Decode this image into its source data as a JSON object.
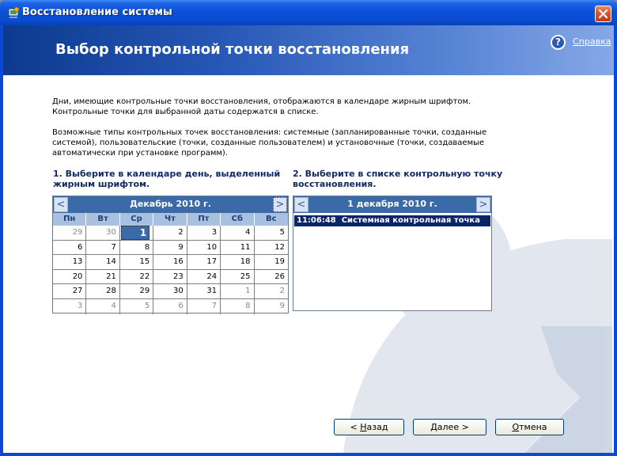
{
  "window": {
    "title": "Восстановление системы",
    "colors": {
      "titlebar": "#0a4bd0",
      "close": "#d8502c"
    }
  },
  "header": {
    "title": "Выбор контрольной точки восстановления",
    "help_label": "Справка",
    "help_glyph": "?"
  },
  "info": {
    "para1_line1": "Дни, имеющие контрольные точки восстановления, отображаются в календаре жирным шрифтом.",
    "para1_line2": "Контрольные точки для выбранной даты содержатся в списке.",
    "para2_line1": "Возможные типы контрольных точек восстановления: системные (запланированные точки, созданные",
    "para2_line2": "системой), пользовательские (точки, созданные пользователем) и установочные (точки, создаваемые",
    "para2_line3": "автоматически при установке программ)."
  },
  "step1": {
    "line1": "1. Выберите в календаре день, выделенный",
    "line2": "жирным шрифтом."
  },
  "step2": {
    "line1": "2. Выберите в списке контрольную точку",
    "line2": "восстановления."
  },
  "calendar": {
    "month_label": "Декабрь 2010 г.",
    "prev": "<",
    "next": ">",
    "weekdays": [
      "Пн",
      "Вт",
      "Ср",
      "Чт",
      "Пт",
      "Сб",
      "Вс"
    ],
    "weeks": [
      [
        "29",
        "30",
        "1",
        "2",
        "3",
        "4",
        "5"
      ],
      [
        "6",
        "7",
        "8",
        "9",
        "10",
        "11",
        "12"
      ],
      [
        "13",
        "14",
        "15",
        "16",
        "17",
        "18",
        "19"
      ],
      [
        "20",
        "21",
        "22",
        "23",
        "24",
        "25",
        "26"
      ],
      [
        "27",
        "28",
        "29",
        "30",
        "31",
        "1",
        "2"
      ],
      [
        "3",
        "4",
        "5",
        "6",
        "7",
        "8",
        "9"
      ]
    ],
    "selected": "1"
  },
  "pointlist": {
    "date_label": "1 декабря 2010 г.",
    "prev": "<",
    "next": ">",
    "items": [
      {
        "time": "11:06:48",
        "label": "Системная контрольная точка"
      }
    ]
  },
  "buttons": {
    "back_prefix": "< ",
    "back_hot": "Н",
    "back_rest": "азад",
    "next_prefix": "",
    "next_hot": "Д",
    "next_rest": "алее >",
    "cancel_prefix": "",
    "cancel_hot": "О",
    "cancel_rest": "тмена"
  }
}
